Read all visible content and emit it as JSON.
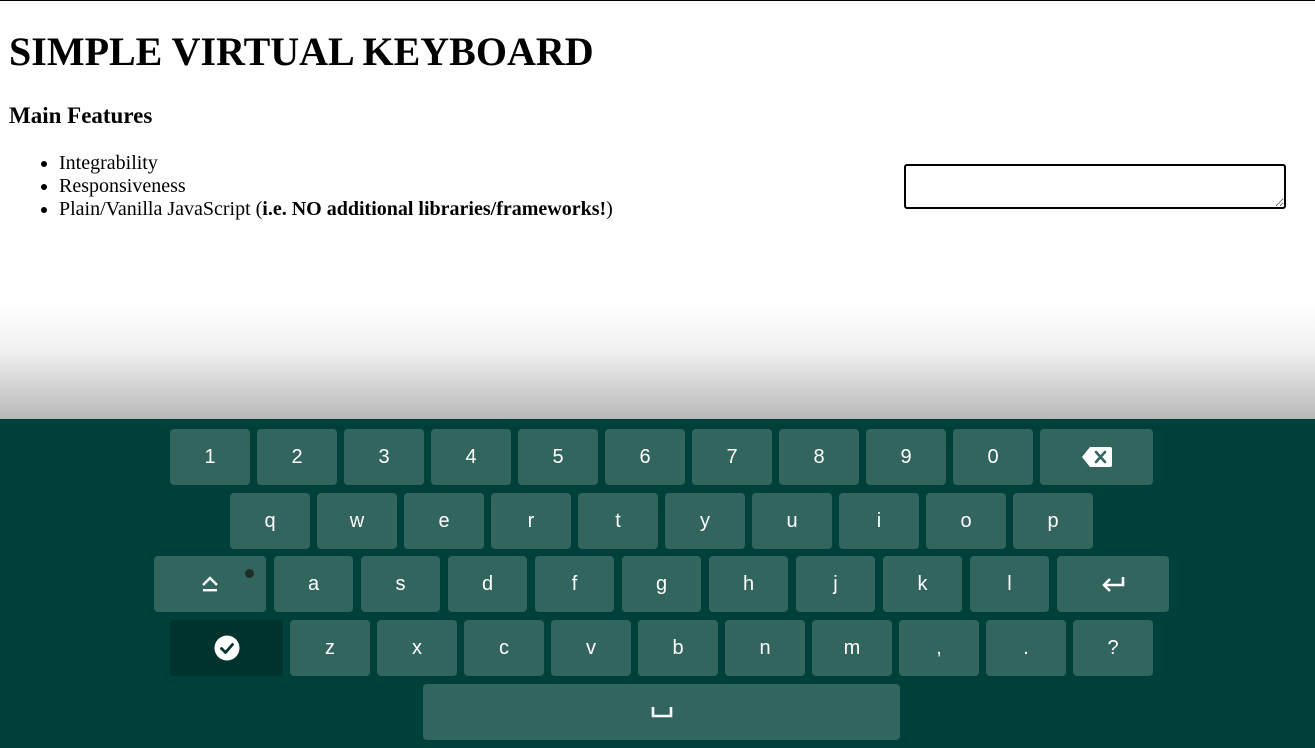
{
  "page": {
    "title": "SIMPLE VIRTUAL KEYBOARD",
    "features_heading": "Main Features",
    "features": [
      {
        "text": "Integrability"
      },
      {
        "text": "Responsiveness"
      },
      {
        "text": "Plain/Vanilla JavaScript (",
        "bold": "i.e. NO additional libraries/frameworks!",
        "suffix": ")"
      }
    ],
    "textarea": {
      "value": ""
    }
  },
  "keyboard": {
    "colors": {
      "background": "#00403a",
      "key": "#33655f",
      "key_dark": "#00332e",
      "text": "#ffffff"
    },
    "rows": [
      {
        "keys": [
          "1",
          "2",
          "3",
          "4",
          "5",
          "6",
          "7",
          "8",
          "9",
          "0"
        ],
        "special_end": "backspace-icon"
      },
      {
        "keys": [
          "q",
          "w",
          "e",
          "r",
          "t",
          "y",
          "u",
          "i",
          "o",
          "p"
        ]
      },
      {
        "special_start": "caps-lock-icon",
        "keys": [
          "a",
          "s",
          "d",
          "f",
          "g",
          "h",
          "j",
          "k",
          "l"
        ],
        "special_end": "enter-icon"
      },
      {
        "special_start": "done-check-icon",
        "keys": [
          "z",
          "x",
          "c",
          "v",
          "b",
          "n",
          "m",
          ",",
          ".",
          "?"
        ]
      },
      {
        "special": "space-icon"
      }
    ]
  }
}
